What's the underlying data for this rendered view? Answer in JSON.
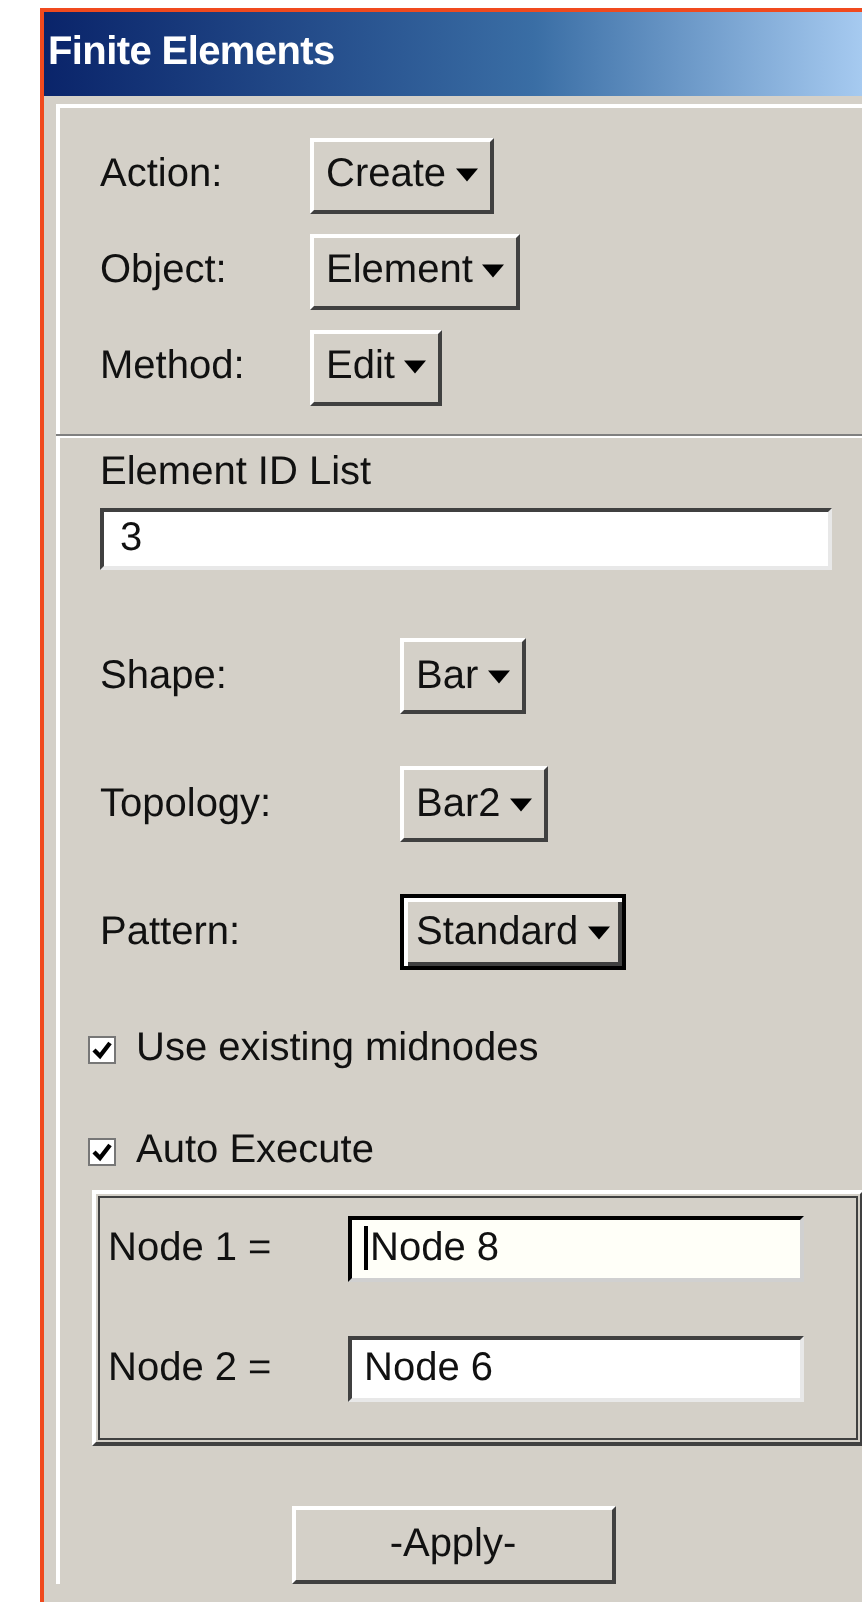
{
  "window": {
    "title": "Finite Elements"
  },
  "top_options": [
    {
      "label": "Action:",
      "value": "Create",
      "focused": false
    },
    {
      "label": "Object:",
      "value": "Element",
      "focused": false
    },
    {
      "label": "Method:",
      "value": "Edit",
      "focused": false
    }
  ],
  "id_list": {
    "label": "Element ID List",
    "value": "3"
  },
  "shape_options": [
    {
      "label": "Shape:",
      "value": "Bar",
      "focused": false
    },
    {
      "label": "Topology:",
      "value": "Bar2",
      "focused": false
    },
    {
      "label": "Pattern:",
      "value": "Standard",
      "focused": true
    }
  ],
  "checkboxes": [
    {
      "label": "Use existing midnodes",
      "checked": true
    },
    {
      "label": "Auto Execute",
      "checked": true
    }
  ],
  "nodes": [
    {
      "label": "Node 1 =",
      "value": "Node 8",
      "focused": true
    },
    {
      "label": "Node 2 =",
      "value": "Node 6",
      "focused": false
    }
  ],
  "apply_button": "-Apply-"
}
